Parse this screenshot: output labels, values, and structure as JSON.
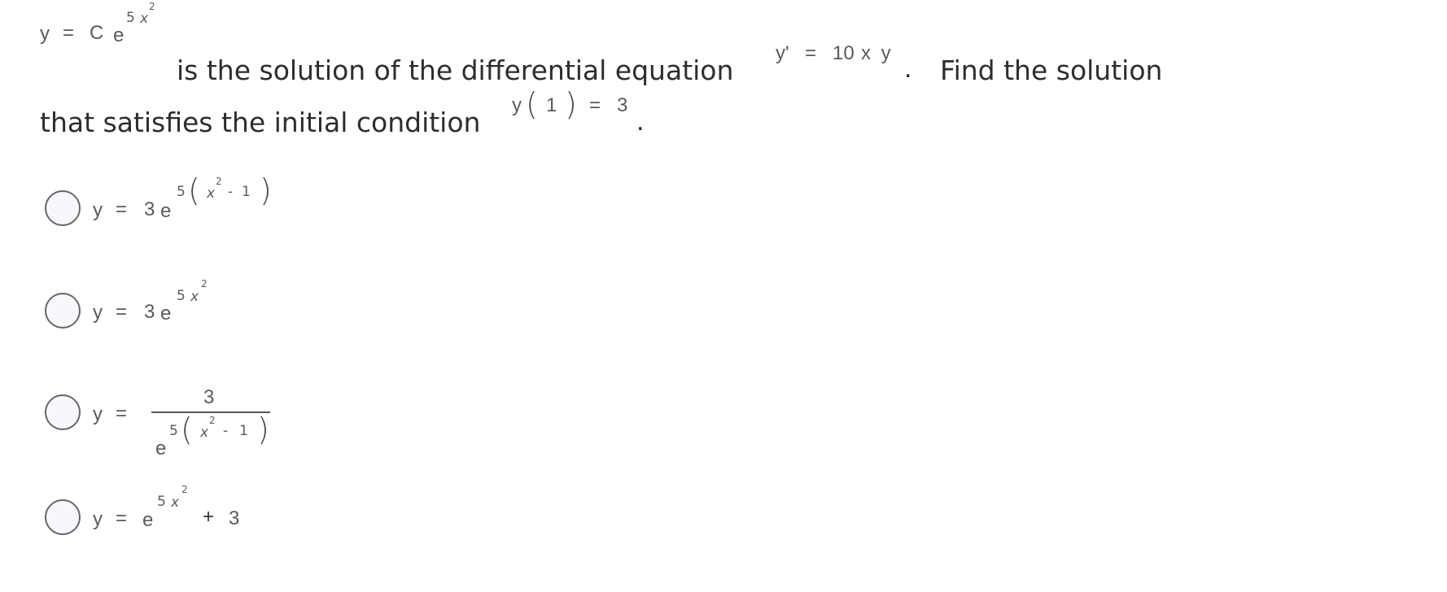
{
  "question": {
    "given_solution": {
      "lhs": "y",
      "eq": "=",
      "coef": "C",
      "base": "e",
      "exp_coef": "5",
      "exp_var": "x",
      "exp_pow": "2"
    },
    "text_1": "is the solution of the differential equation",
    "de": {
      "lhs": "y'",
      "eq": "=",
      "rhs_num": "10",
      "rhs_vars": "x y"
    },
    "period_1": ".",
    "text_2": "Find the solution",
    "text_3": "that satisfies the initial condition",
    "ic": {
      "fn": "y",
      "open": "(",
      "arg": "1",
      "close": ")",
      "eq": "=",
      "val": "3"
    },
    "period_2": "."
  },
  "options": [
    {
      "id": "a",
      "selected": false,
      "lhs": "y",
      "eq": "=",
      "coef": "3",
      "base": "e",
      "exp_coef": "5",
      "open": "(",
      "var": "x",
      "pow": "2",
      "minus": "-",
      "one": "1",
      "close": ")"
    },
    {
      "id": "b",
      "selected": false,
      "lhs": "y",
      "eq": "=",
      "coef": "3",
      "base": "e",
      "exp_coef": "5",
      "var": "x",
      "pow": "2"
    },
    {
      "id": "c",
      "selected": false,
      "lhs": "y",
      "eq": "=",
      "numerator": "3",
      "base": "e",
      "exp_coef": "5",
      "open": "(",
      "var": "x",
      "pow": "2",
      "minus": "-",
      "one": "1",
      "close": ")"
    },
    {
      "id": "d",
      "selected": false,
      "lhs": "y",
      "eq": "=",
      "base": "e",
      "exp_coef": "5",
      "var": "x",
      "pow": "2",
      "plus": "+",
      "const": "3"
    }
  ]
}
